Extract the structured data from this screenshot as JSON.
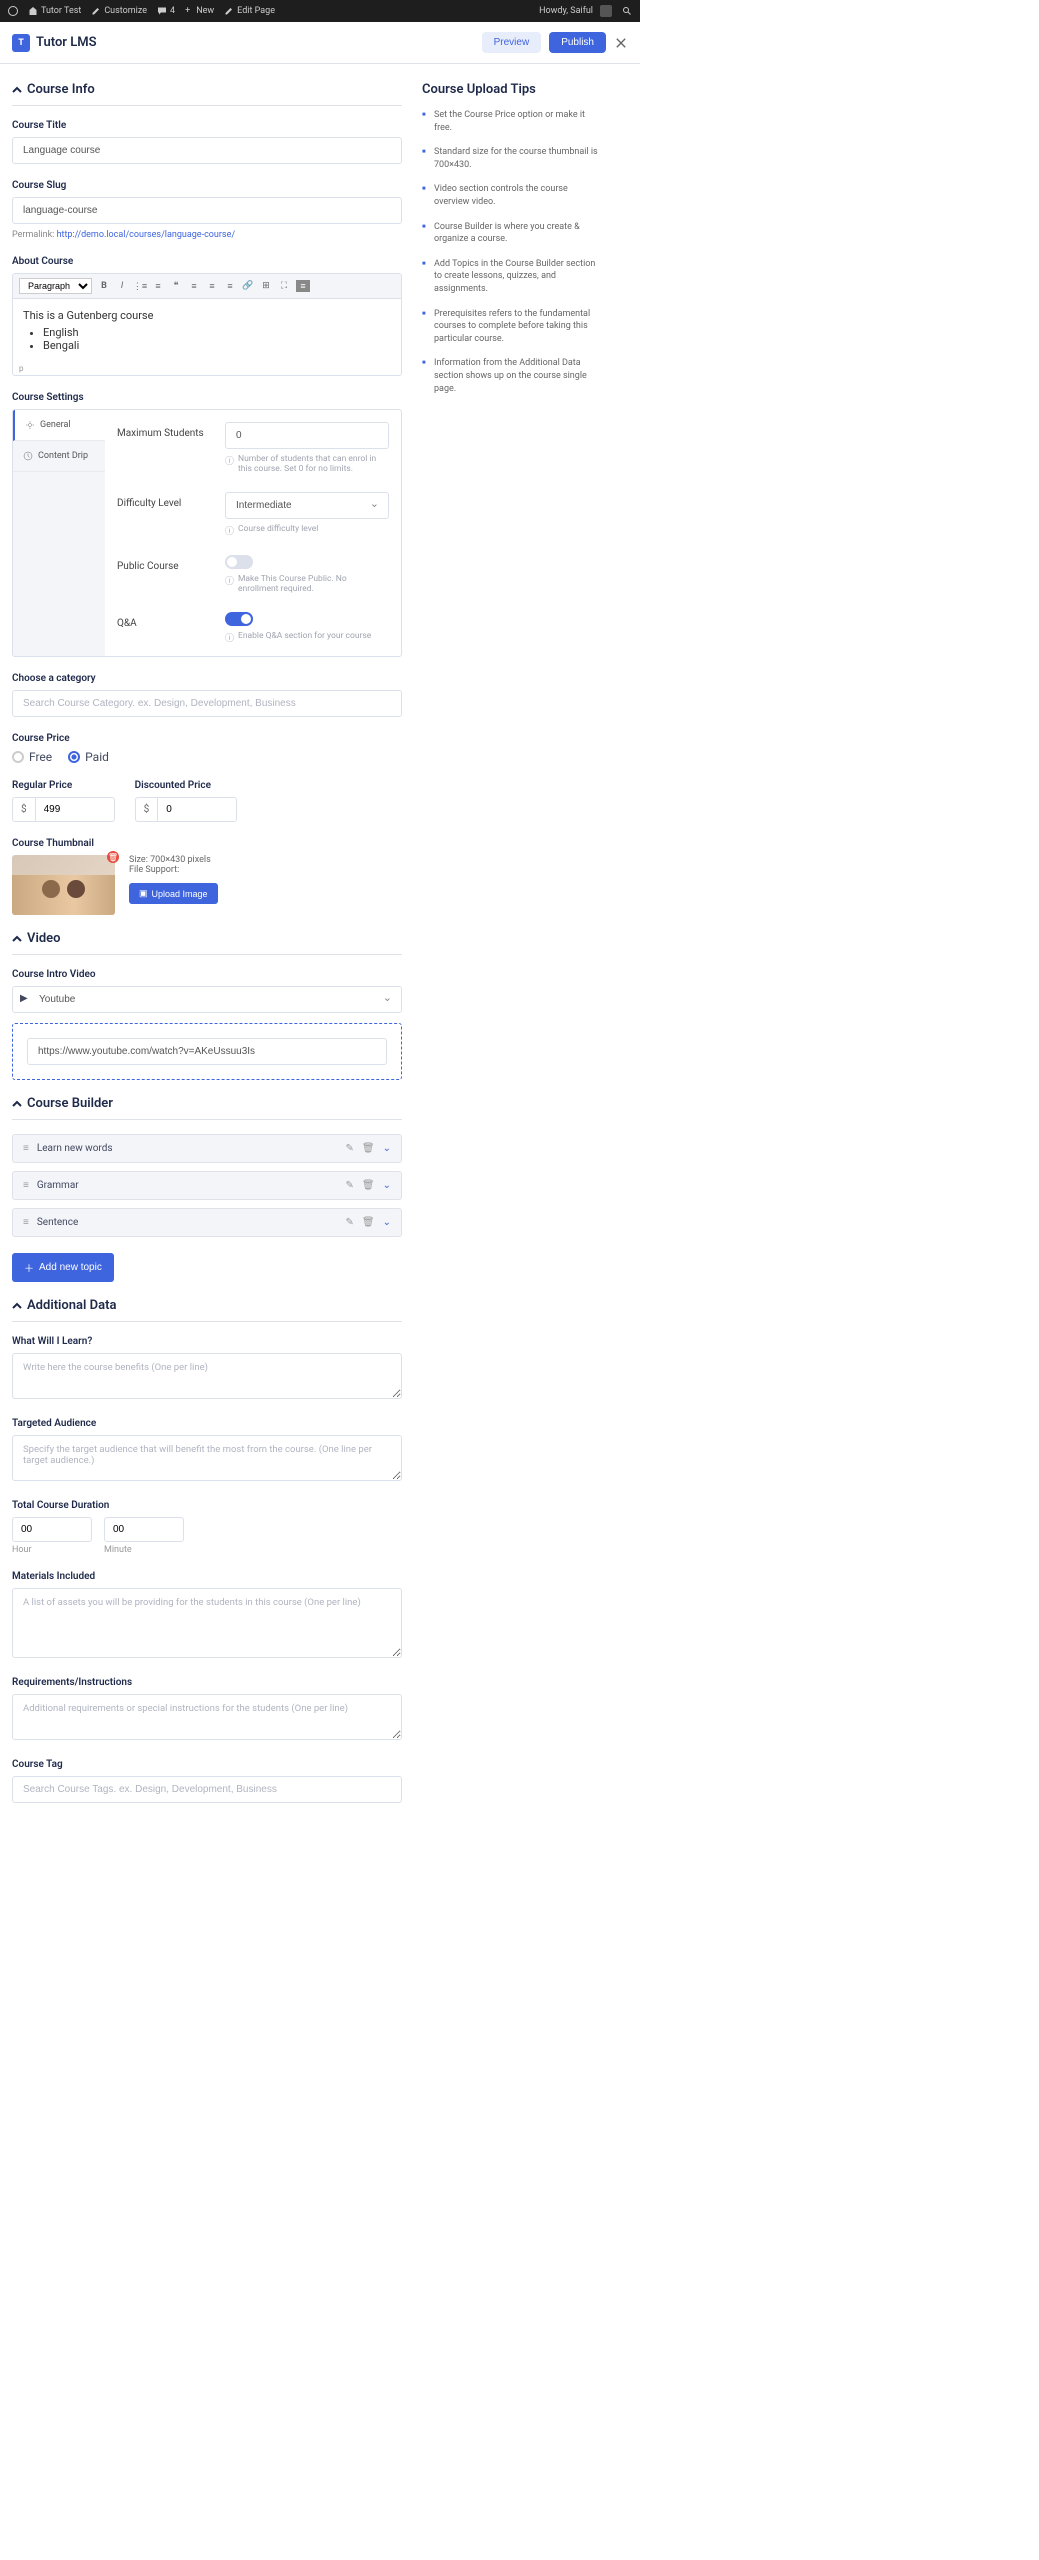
{
  "admin_bar": {
    "site_name": "Tutor Test",
    "customize": "Customize",
    "comments": "4",
    "new": "New",
    "edit_page": "Edit Page",
    "greeting": "Howdy, Saiful"
  },
  "header": {
    "logo_text": "Tutor LMS",
    "preview": "Preview",
    "publish": "Publish"
  },
  "sections": {
    "course_info": "Course Info",
    "video": "Video",
    "course_builder": "Course Builder",
    "additional_data": "Additional Data"
  },
  "course_title": {
    "label": "Course Title",
    "value": "Language course"
  },
  "course_slug": {
    "label": "Course Slug",
    "value": "language-course",
    "permalink_label": "Permalink:",
    "permalink_url": "http://demo.local/courses/language-course/"
  },
  "about_course": {
    "label": "About Course",
    "paragraph_label": "Paragraph",
    "content_intro": "This is a Gutenberg course",
    "content_list": [
      "English",
      "Bengali"
    ],
    "status": "p"
  },
  "course_settings": {
    "label": "Course Settings",
    "tabs": {
      "general": "General",
      "content_drip": "Content Drip"
    },
    "max_students": {
      "label": "Maximum Students",
      "value": "0",
      "help": "Number of students that can enrol in this course. Set 0 for no limits."
    },
    "difficulty": {
      "label": "Difficulty Level",
      "value": "Intermediate",
      "help": "Course difficulty level"
    },
    "public_course": {
      "label": "Public Course",
      "help": "Make This Course Public. No enrollment required."
    },
    "qa": {
      "label": "Q&A",
      "help": "Enable Q&A section for your course"
    }
  },
  "category": {
    "label": "Choose a category",
    "placeholder": "Search Course Category. ex. Design, Development, Business"
  },
  "price": {
    "label": "Course Price",
    "free": "Free",
    "paid": "Paid",
    "regular_label": "Regular Price",
    "regular_value": "499",
    "discounted_label": "Discounted Price",
    "discounted_value": "0",
    "currency": "$"
  },
  "thumbnail": {
    "label": "Course Thumbnail",
    "size": "Size: 700×430 pixels",
    "support": "File Support:",
    "upload": "Upload Image"
  },
  "video": {
    "label": "Course Intro Video",
    "source": "Youtube",
    "url": "https://www.youtube.com/watch?v=AKeUssuu3Is"
  },
  "builder": {
    "topics": [
      "Learn new words",
      "Grammar",
      "Sentence"
    ],
    "add_topic": "Add new topic"
  },
  "additional": {
    "learn_label": "What Will I Learn?",
    "learn_placeholder": "Write here the course benefits (One per line)",
    "audience_label": "Targeted Audience",
    "audience_placeholder": "Specify the target audience that will benefit the most from the course. (One line per target audience.)",
    "duration_label": "Total Course Duration",
    "hour_value": "00",
    "hour_label": "Hour",
    "minute_value": "00",
    "minute_label": "Minute",
    "materials_label": "Materials Included",
    "materials_placeholder": "A list of assets you will be providing for the students in this course (One per line)",
    "requirements_label": "Requirements/Instructions",
    "requirements_placeholder": "Additional requirements or special instructions for the students (One per line)",
    "tag_label": "Course Tag",
    "tag_placeholder": "Search Course Tags. ex. Design, Development, Business"
  },
  "tips": {
    "title": "Course Upload Tips",
    "items": [
      "Set the Course Price option or make it free.",
      "Standard size for the course thumbnail is 700×430.",
      "Video section controls the course overview video.",
      "Course Builder is where you create & organize a course.",
      "Add Topics in the Course Builder section to create lessons, quizzes, and assignments.",
      "Prerequisites refers to the fundamental courses to complete before taking this particular course.",
      "Information from the Additional Data section shows up on the course single page."
    ]
  }
}
